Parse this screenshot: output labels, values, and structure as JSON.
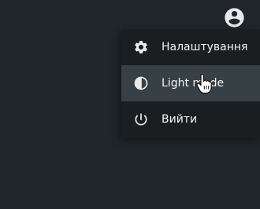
{
  "header": {
    "avatar_icon": "account-circle-icon"
  },
  "menu": {
    "items": [
      {
        "label": "Налаштування",
        "icon": "gear-icon"
      },
      {
        "label": "Light mode",
        "icon": "contrast-icon",
        "hovered": true
      },
      {
        "label": "Вийти",
        "icon": "power-icon"
      }
    ]
  },
  "colors": {
    "background": "#20262b",
    "menu_background": "#1b1e21",
    "hover_background": "#374044",
    "text": "#f2f4f5",
    "icon": "#e8eaeb"
  }
}
